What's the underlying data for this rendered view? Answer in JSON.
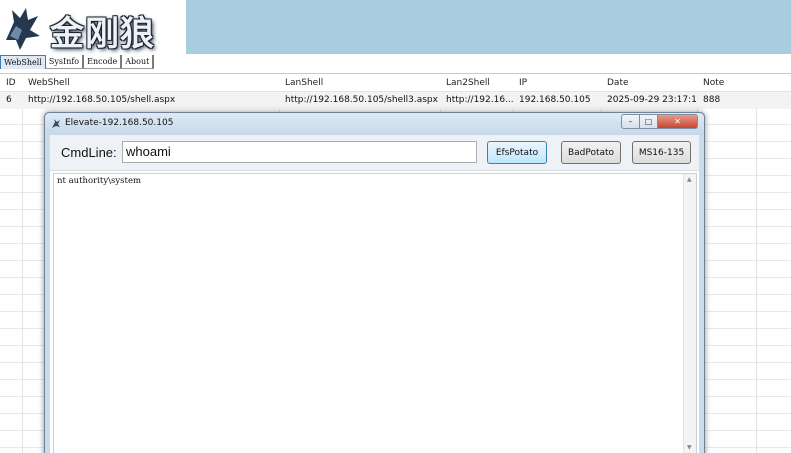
{
  "app": {
    "logo_text": "金刚狼"
  },
  "menu": [
    {
      "label": "WebShell"
    },
    {
      "label": "SysInfo"
    },
    {
      "label": "Encode"
    },
    {
      "label": "About"
    }
  ],
  "table": {
    "columns": [
      "ID",
      "WebShell",
      "LanShell",
      "Lan2Shell",
      "IP",
      "Date",
      "Note"
    ],
    "rows": [
      [
        "6",
        "http://192.168.50.105/shell.aspx",
        "http://192.168.50.105/shell3.aspx",
        "http://192.16...",
        "192.168.50.105",
        "2025-09-29 23:17:19",
        "888"
      ]
    ]
  },
  "dialog": {
    "title": "Elevate-192.168.50.105",
    "cmd_label": "CmdLine:",
    "cmd_value": "whoami",
    "buttons": {
      "efs": "EfsPotato",
      "bad": "BadPotato",
      "ms": "MS16-135"
    },
    "output": "nt authority\\system"
  },
  "colors": {
    "banner": "#a9cde0",
    "dialog_frame": "#c8dcec",
    "accent": "#3c7fb1"
  }
}
